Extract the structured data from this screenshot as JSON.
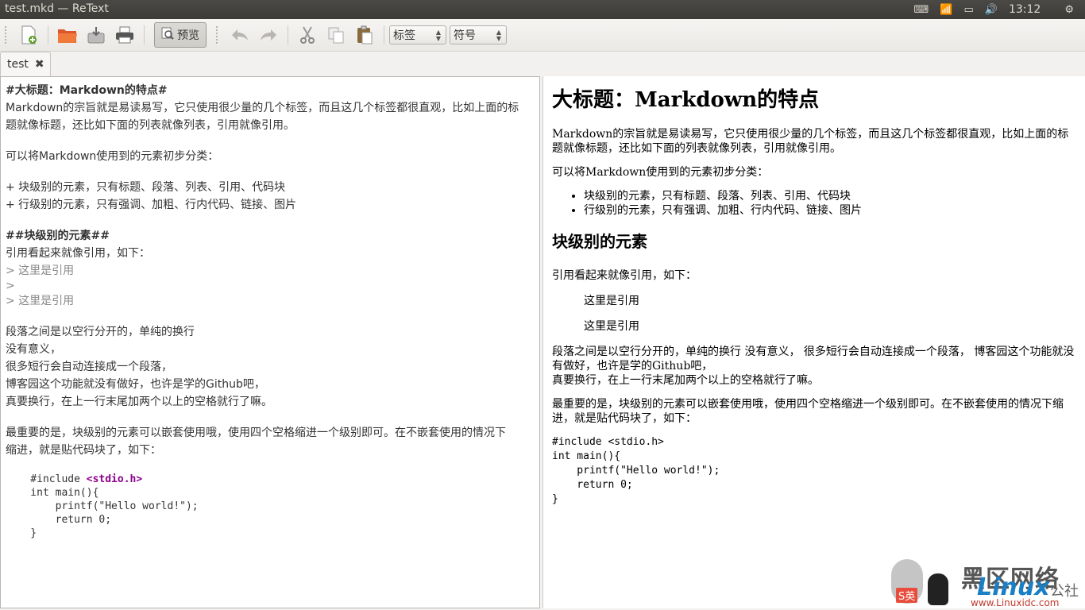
{
  "window_title": "test.mkd — ReText",
  "tray": {
    "keyboard": "⌨",
    "wifi": "📶",
    "battery": "▭",
    "volume": "🔊",
    "clock": "13:12",
    "power": "⚙"
  },
  "toolbar": {
    "new": "new-document-icon",
    "open": "open-folder-icon",
    "save": "save-icon",
    "print": "print-icon",
    "preview_label": "预览",
    "undo": "undo-icon",
    "redo": "redo-icon",
    "cut": "cut-icon",
    "copy": "copy-icon",
    "paste": "paste-icon",
    "tags_label": "标签",
    "symbols_label": "符号"
  },
  "tab": {
    "label": "test"
  },
  "editor": {
    "lines": [
      "#大标题：Markdown的特点#",
      "Markdown的宗旨就是易读易写，它只使用很少量的几个标签，而且这几个标签都很直观，比如上面的标",
      "题就像标题，还比如下面的列表就像列表，引用就像引用。",
      "",
      "可以将Markdown使用到的元素初步分类：",
      "",
      "+ 块级别的元素，只有标题、段落、列表、引用、代码块",
      "+ 行级别的元素，只有强调、加粗、行内代码、链接、图片",
      "",
      "##块级别的元素##",
      "引用看起来就像引用，如下：",
      "> 这里是引用",
      ">",
      "> 这里是引用",
      "",
      "段落之间是以空行分开的，单纯的换行",
      "没有意义，",
      "很多短行会自动连接成一个段落，",
      "博客园这个功能就没有做好，也许是学的Github吧，",
      "真要换行，在上一行末尾加两个以上的空格就行了嘛。",
      "",
      "最重要的是，块级别的元素可以嵌套使用哦，使用四个空格缩进一个级别即可。在不嵌套使用的情况下",
      "缩进，就是贴代码块了，如下："
    ],
    "code": {
      "include": "    #include ",
      "header": "<stdio.h>",
      "l2": "    int main(){",
      "l3": "        printf(\"Hello world!\");",
      "l4": "        return 0;",
      "l5": "    }"
    }
  },
  "preview": {
    "h1": "大标题：Markdown的特点",
    "p1": "Markdown的宗旨就是易读易写，它只使用很少量的几个标签，而且这几个标签都很直观，比如上面的标题就像标题，还比如下面的列表就像列表，引用就像引用。",
    "p2": "可以将Markdown使用到的元素初步分类：",
    "li1": "块级别的元素，只有标题、段落、列表、引用、代码块",
    "li2": "行级别的元素，只有强调、加粗、行内代码、链接、图片",
    "h2": "块级别的元素",
    "p3": "引用看起来就像引用，如下：",
    "q1": "这里是引用",
    "q2": "这里是引用",
    "p4a": "段落之间是以空行分开的，单纯的换行 没有意义， 很多短行会自动连接成一个段落， 博客园这个功能就没有做好，也许是学的Github吧，",
    "p4b": "真要换行，在上一行末尾加两个以上的空格就行了嘛。",
    "p5": "最重要的是，块级别的元素可以嵌套使用哦，使用四个空格缩进一个级别即可。在不嵌套使用的情况下缩进，就是贴代码块了，如下：",
    "code": "#include <stdio.h>\nint main(){\n    printf(\"Hello world!\");\n    return 0;\n}"
  },
  "watermark": {
    "t1": "黑区网络",
    "t2": "Linux",
    "t3": "公社",
    "url": "www.Linuxidc.com",
    "ime": "S英"
  }
}
